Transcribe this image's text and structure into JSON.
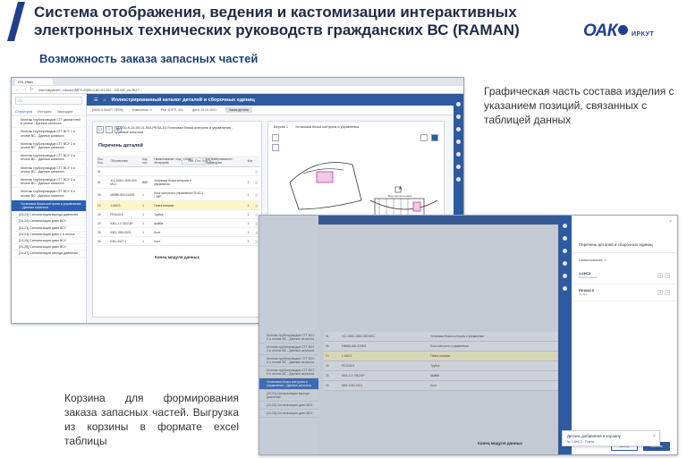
{
  "slide": {
    "title": "Система отображения, ведения и кастомизации интерактивных электронных технических руководств гражданских ВС (RAMAN)",
    "subtitle": "Возможность заказа запасных частей",
    "logo_main": "ОАК",
    "logo_sub": "ИРКУТ",
    "caption_right": "Графическая часть состава изделия с указанием позиций, связанных с таблицей данных",
    "caption_left": "Корзина для формирования заказа запасных частей. Выгрузка из корзины в формате excel таблицы",
    "accent_color": "#1f3f8e"
  },
  "screen1": {
    "tab_label": "ИЭ_Ивис",
    "url": "eservalpanel/.../docs/UMF2-2000-0-60-01-01/.../02-DE_cs-RU?...",
    "sidebar": {
      "search": "Go",
      "tabs": [
        "Структура",
        "История",
        "Закладки"
      ],
      "items": [
        "Монтаж трубопроводов СТГ двигателей в отсеке - Данные каталога",
        "Монтаж трубопроводов СТГ ВСУ 1 и отсеке ВС - Данные каталога",
        "Монтаж трубопроводов СТГ ВСУ 2 и отсеке ВС - Данные каталога",
        "Монтаж трубопроводов СТГ ВСУ 3 и отсеке ВС - Данные каталога",
        "Монтаж трубопроводов СТГ ВСУ 4 и отсеке ВС - Данные каталога",
        "Монтаж трубопроводов СТГ ВСУ 5 и отсеке ВС - Данные каталога",
        "Монтаж трубопроводов СТГ ВСУ 6 и отсеке ВС - Данные каталога"
      ],
      "selected": "Установка блока контроля и управления - Данные каталога",
      "sub_items": [
        "[24-21] Сигнализация выхода давления",
        "[24-22] Сигнализация давл ВСУ",
        "[24-23] Сигнализация давл ВСУ",
        "[24-24] Сигнализация давл 2 в отсеке",
        "[24-25] Сигнализация давл ВСУ",
        "[24-26] Сигнализация давл ВСУ",
        "[24-27] Сигнализация выхода давления"
      ]
    },
    "app_title": "Иллюстрированный каталог деталей и сборочных единиц",
    "info_fields": [
      "[А000-0-МАЛТ ПРЕВ]",
      "Изменение: 0",
      "Рев. ИЭТР: 001",
      "Дата: 01.01.2021"
    ],
    "order_button": "Заказ детали",
    "left_panel_header": "[21000-К-24-00-01-504-PKSA-D] Установка блока контроля и управления - Данные каталога",
    "parts_title": "Перечень деталей",
    "parts_filter": "Исх. Пос. Кол. ч.",
    "columns": [
      "Поз. Пос.",
      "Обозначение",
      "Код пос.",
      "Наименование / Код / Склад / Интерфейс",
      "Код применяемости / Примечание",
      "Кол."
    ],
    "rows": [
      [
        "01",
        "",
        "",
        "",
        "",
        ""
      ],
      [
        "01",
        "111-10001-3000-000 МСС",
        "ВВЕ",
        "Установка блока контроля и управления",
        "",
        "1"
      ],
      [
        "05",
        "МК980-600-01/003",
        "1",
        "Блок контроля и управления ПЗ-К2.1 / ЗИП",
        "",
        "1"
      ],
      [
        "10",
        "1-КНС3",
        "1",
        "Плата питания",
        "",
        "1"
      ],
      [
        "15",
        "РЕ1043-5",
        "1",
        "Трубка",
        "",
        "1"
      ],
      [
        "20",
        "Ю61-1-0 7510-6Р",
        "1",
        "Шайба",
        "",
        "1"
      ],
      [
        "25",
        "Ю61-1000-0001",
        "1",
        "Болт",
        "",
        "1"
      ],
      [
        "30",
        "Ю61-3417-1",
        "1",
        "Болт",
        "",
        "1"
      ]
    ],
    "end_label": "Конец модуля данных",
    "right_panel_header": "Установка блока контроля и управления",
    "version_label": "Версия 1",
    "figure_caption": "ИЧЗ-21000-К-24-00-00-0-МАЛТ-ЛЕЧС-А-00-01",
    "fig_callouts": [
      "А",
      "Вид против полета",
      "В"
    ]
  },
  "screen2": {
    "end_label": "Конец модуля данных",
    "rows": [
      [
        "01",
        "111-10001-3000-000 МСС",
        "Установка блока контроля и управления"
      ],
      [
        "05",
        "МК980-600-01/003",
        "Блок контроля и управления"
      ],
      [
        "10",
        "1-КНС3",
        "Плата питания"
      ],
      [
        "15",
        "РЕ1043-5",
        "Трубка"
      ],
      [
        "20",
        "Ю61-1-0 7510-6Р",
        "Шайба"
      ],
      [
        "25",
        "Ю61-1000-0001",
        "Болт"
      ]
    ],
    "cart_title": "Перечень деталей и сборочных единиц",
    "cart_count": "Наименований: 2",
    "cart_items": [
      {
        "name": "1-КНС3",
        "sub": "Плата питания",
        "qty": "1"
      },
      {
        "name": "РЕ1043-5",
        "sub": "Трубка",
        "qty": "1"
      }
    ],
    "buttons": [
      "Экспорт",
      "Заказать"
    ],
    "toast_title": "Деталь добавлена в корзину",
    "toast_sub": "№ 1-КНС3 - Плата"
  }
}
